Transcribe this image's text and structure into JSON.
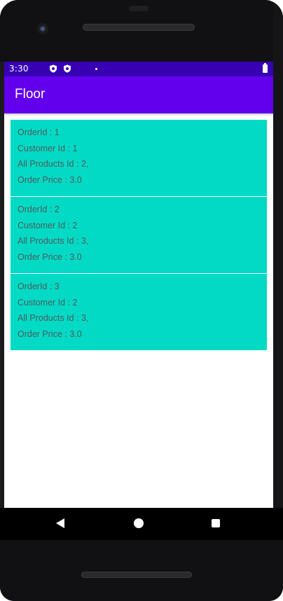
{
  "colors": {
    "status_bar": "#3700b3",
    "app_bar": "#6200ee",
    "card": "#03dac5",
    "card_text": "#4f5b5b"
  },
  "status_bar": {
    "time": "3:30",
    "icons": [
      "shield-icon",
      "shield-icon",
      "notification-dot-icon",
      "battery-icon"
    ]
  },
  "app_bar": {
    "title": "Floor"
  },
  "orders": [
    {
      "order_id": "OrderId : 1",
      "customer_id": "Customer Id : 1",
      "products": "All Products Id : 2,",
      "price": "Order Price : 3.0"
    },
    {
      "order_id": "OrderId : 2",
      "customer_id": "Customer Id : 2",
      "products": "All Products Id : 3,",
      "price": "Order Price : 3.0"
    },
    {
      "order_id": "OrderId : 3",
      "customer_id": "Customer Id : 2",
      "products": "All Products Id : 3,",
      "price": "Order Price : 3.0"
    }
  ],
  "nav_bar": {
    "icons": [
      "back-icon",
      "home-icon",
      "recents-icon"
    ]
  }
}
